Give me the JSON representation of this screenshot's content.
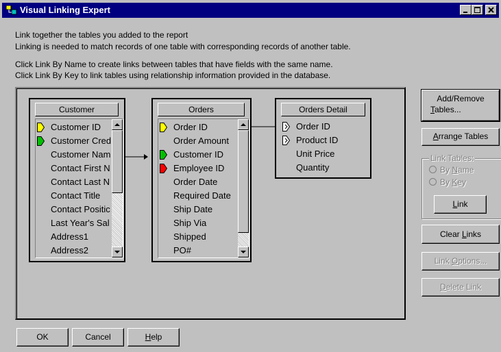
{
  "window": {
    "title": "Visual Linking Expert"
  },
  "intro": {
    "line1": "Link together the tables you added to the report",
    "line2": "Linking is needed to match records of one table with corresponding records of another table.",
    "line3": "Click Link By Name to create links between tables that have fields with the same name.",
    "line4": "Click Link By Key to link tables using relationship information provided in the database."
  },
  "tables": {
    "customer": {
      "name": "Customer",
      "fields": [
        "Customer ID",
        "Customer Cred",
        "Customer Nam",
        "Contact First N",
        "Contact Last N",
        "Contact Title",
        "Contact Positic",
        "Last Year's Sal",
        "Address1",
        "Address2"
      ],
      "key_colors": [
        "#ffff00",
        "#00c000"
      ]
    },
    "orders": {
      "name": "Orders",
      "fields": [
        "Order ID",
        "Order Amount",
        "Customer ID",
        "Employee ID",
        "Order Date",
        "Required Date",
        "Ship Date",
        "Ship Via",
        "Shipped",
        "PO#"
      ],
      "key_colors": [
        "#ffff00",
        "#00c000",
        "#ff0000"
      ]
    },
    "orders_detail": {
      "name": "Orders Detail",
      "fields": [
        "Order ID",
        "Product ID",
        "Unit Price",
        "Quantity"
      ],
      "key_colors": [
        "#ffffff",
        "#ffffff"
      ]
    }
  },
  "buttons": {
    "add_remove_1": "Add/Remove",
    "add_remove_2a": "T",
    "add_remove_2b": "ables...",
    "arrange_a": "A",
    "arrange_b": "rrange Tables",
    "link_tables_group": "Link Tables:",
    "by_name_a": "By ",
    "by_name_b": "N",
    "by_name_c": "ame",
    "by_key_a": "By ",
    "by_key_b": "K",
    "by_key_c": "ey",
    "link_a": "L",
    "link_b": "ink",
    "clear_a": "Clear ",
    "clear_b": "L",
    "clear_c": "inks",
    "link_options_a": "Link ",
    "link_options_b": "O",
    "link_options_c": "ptions...",
    "delete_a": "D",
    "delete_b": "elete Link",
    "ok": "OK",
    "cancel": "Cancel",
    "help_a": "H",
    "help_b": "elp"
  },
  "colors": {
    "titlebar": "#000080",
    "face": "#c0c0c0"
  },
  "icons": [
    "app-icon",
    "minimize-icon",
    "maximize-icon",
    "close-icon",
    "key-icon",
    "scroll-up-arrow-icon",
    "scroll-down-arrow-icon",
    "link-arrow-icon"
  ]
}
